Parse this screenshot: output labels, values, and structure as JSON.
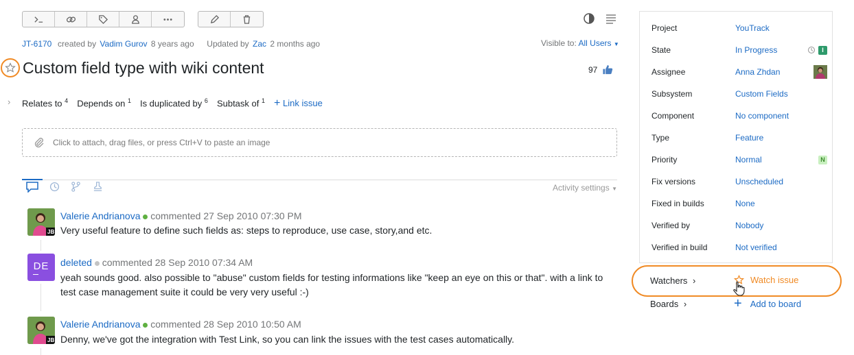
{
  "issue": {
    "id": "JT-6170",
    "created_by_prefix": "created by",
    "author": "Vadim Gurov",
    "created_ago": "8 years ago",
    "updated_prefix": "Updated by",
    "updater": "Zac",
    "updated_ago": "2 months ago",
    "visible_to_label": "Visible to:",
    "visible_to_value": "All Users",
    "title": "Custom field type with wiki content",
    "votes": "97"
  },
  "links": {
    "items": [
      {
        "label": "Relates to",
        "count": "4"
      },
      {
        "label": "Depends on",
        "count": "1"
      },
      {
        "label": "Is duplicated by",
        "count": "6"
      },
      {
        "label": "Subtask of",
        "count": "1"
      }
    ],
    "link_issue": "Link issue"
  },
  "attach": {
    "text": "Click to attach, drag files, or press Ctrl+V to paste an image"
  },
  "activity": {
    "settings_label": "Activity settings"
  },
  "comments": [
    {
      "author": "Valerie Andrianova",
      "action": "commented",
      "date": "27 Sep 2010 07:30 PM",
      "text": "Very useful feature to define such fields as: steps to reproduce, use case, story,and etc.",
      "badge": "JB"
    },
    {
      "author": "deleted",
      "action": "commented",
      "date": "28 Sep 2010 07:34 AM",
      "text1": "yeah sounds good. also possible to \"abuse\" custom fields for testing informations like \"keep an eye on this or that\". with a link to",
      "text2": "test case management suite it could be very very useful :-)",
      "initials": "DE"
    },
    {
      "author": "Valerie Andrianova",
      "action": "commented",
      "date": "28 Sep 2010 10:50 AM",
      "text": "Denny, we've got the integration with Test Link, so you can link the issues with the test cases automatically.",
      "badge": "JB"
    }
  ],
  "fields": [
    {
      "label": "Project",
      "value": "YouTrack"
    },
    {
      "label": "State",
      "value": "In Progress",
      "badge": "I"
    },
    {
      "label": "Assignee",
      "value": "Anna Zhdan"
    },
    {
      "label": "Subsystem",
      "value": "Custom Fields"
    },
    {
      "label": "Component",
      "value": "No component"
    },
    {
      "label": "Type",
      "value": "Feature"
    },
    {
      "label": "Priority",
      "value": "Normal",
      "badge": "N"
    },
    {
      "label": "Fix versions",
      "value": "Unscheduled"
    },
    {
      "label": "Fixed in builds",
      "value": "None"
    },
    {
      "label": "Verified by",
      "value": "Nobody"
    },
    {
      "label": "Verified in build",
      "value": "Not verified"
    }
  ],
  "watchers": {
    "label": "Watchers",
    "action": "Watch issue"
  },
  "boards": {
    "label": "Boards",
    "action": "Add to board"
  },
  "colors": {
    "accent": "#1b6ac4",
    "highlight": "#f08a24",
    "online": "#5fb041",
    "state_badge": "#2e9a6b",
    "priority_badge": "#c9f0c0"
  }
}
